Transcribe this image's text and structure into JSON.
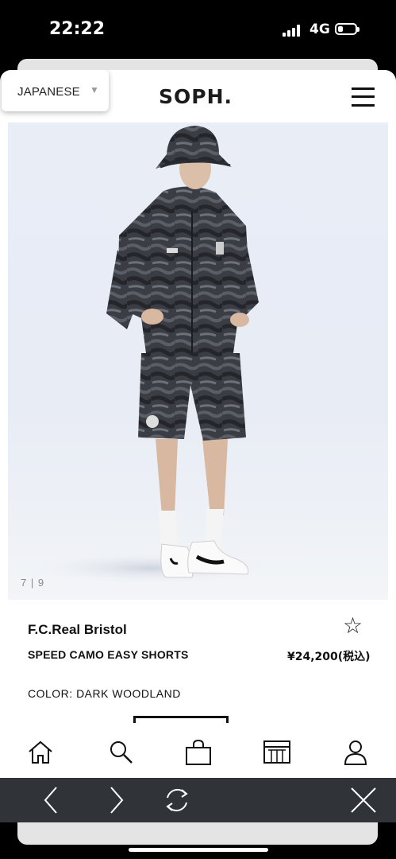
{
  "status_bar": {
    "time": "22:22",
    "network": "4G"
  },
  "header": {
    "language": "JAPANESE",
    "logo": "SOPH."
  },
  "gallery": {
    "current": "7",
    "separator": "|",
    "total": "9"
  },
  "product": {
    "brand": "F.C.Real Bristol",
    "name": "SPEED CAMO EASY SHORTS",
    "price": "¥24,200(税込)",
    "color": "COLOR: DARK WOODLAND"
  },
  "bottom_nav": [
    "home-icon",
    "search-icon",
    "shopping-bag-icon",
    "store-icon",
    "account-icon"
  ],
  "browser_toolbar": [
    "back-icon",
    "forward-icon",
    "refresh-icon",
    "close-icon"
  ]
}
